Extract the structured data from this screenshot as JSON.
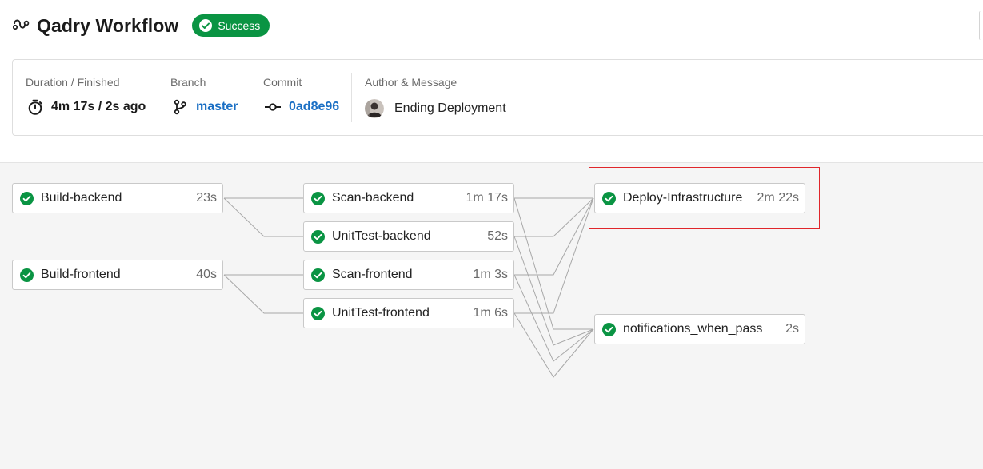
{
  "header": {
    "icon": "workflow-icon",
    "title": "Qadry Workflow",
    "status_badge": {
      "label": "Success",
      "icon": "check-circle-icon",
      "color": "#0a9443"
    }
  },
  "summary": {
    "duration": {
      "label": "Duration / Finished",
      "value": "4m 17s / 2s ago",
      "icon": "stopwatch-icon"
    },
    "branch": {
      "label": "Branch",
      "value": "master",
      "icon": "git-branch-icon"
    },
    "commit": {
      "label": "Commit",
      "value": "0ad8e96",
      "icon": "git-commit-icon"
    },
    "author": {
      "label": "Author & Message",
      "message": "Ending Deployment",
      "icon": "avatar"
    }
  },
  "jobs": [
    {
      "id": "build-backend",
      "name": "Build-backend",
      "duration": "23s",
      "status": "success"
    },
    {
      "id": "build-frontend",
      "name": "Build-frontend",
      "duration": "40s",
      "status": "success"
    },
    {
      "id": "scan-backend",
      "name": "Scan-backend",
      "duration": "1m 17s",
      "status": "success"
    },
    {
      "id": "unittest-backend",
      "name": "UnitTest-backend",
      "duration": "52s",
      "status": "success"
    },
    {
      "id": "scan-frontend",
      "name": "Scan-frontend",
      "duration": "1m 3s",
      "status": "success"
    },
    {
      "id": "unittest-frontend",
      "name": "UnitTest-frontend",
      "duration": "1m 6s",
      "status": "success"
    },
    {
      "id": "deploy-infrastructure",
      "name": "Deploy-Infrastructure",
      "duration": "2m 22s",
      "status": "success",
      "highlighted": true
    },
    {
      "id": "notifications-when-pass",
      "name": "notifications_when_pass",
      "duration": "2s",
      "status": "success"
    }
  ],
  "colors": {
    "success": "#0a9443",
    "link": "#1a6fc4",
    "highlight": "#e0262b",
    "connector": "#a8a8a8"
  }
}
